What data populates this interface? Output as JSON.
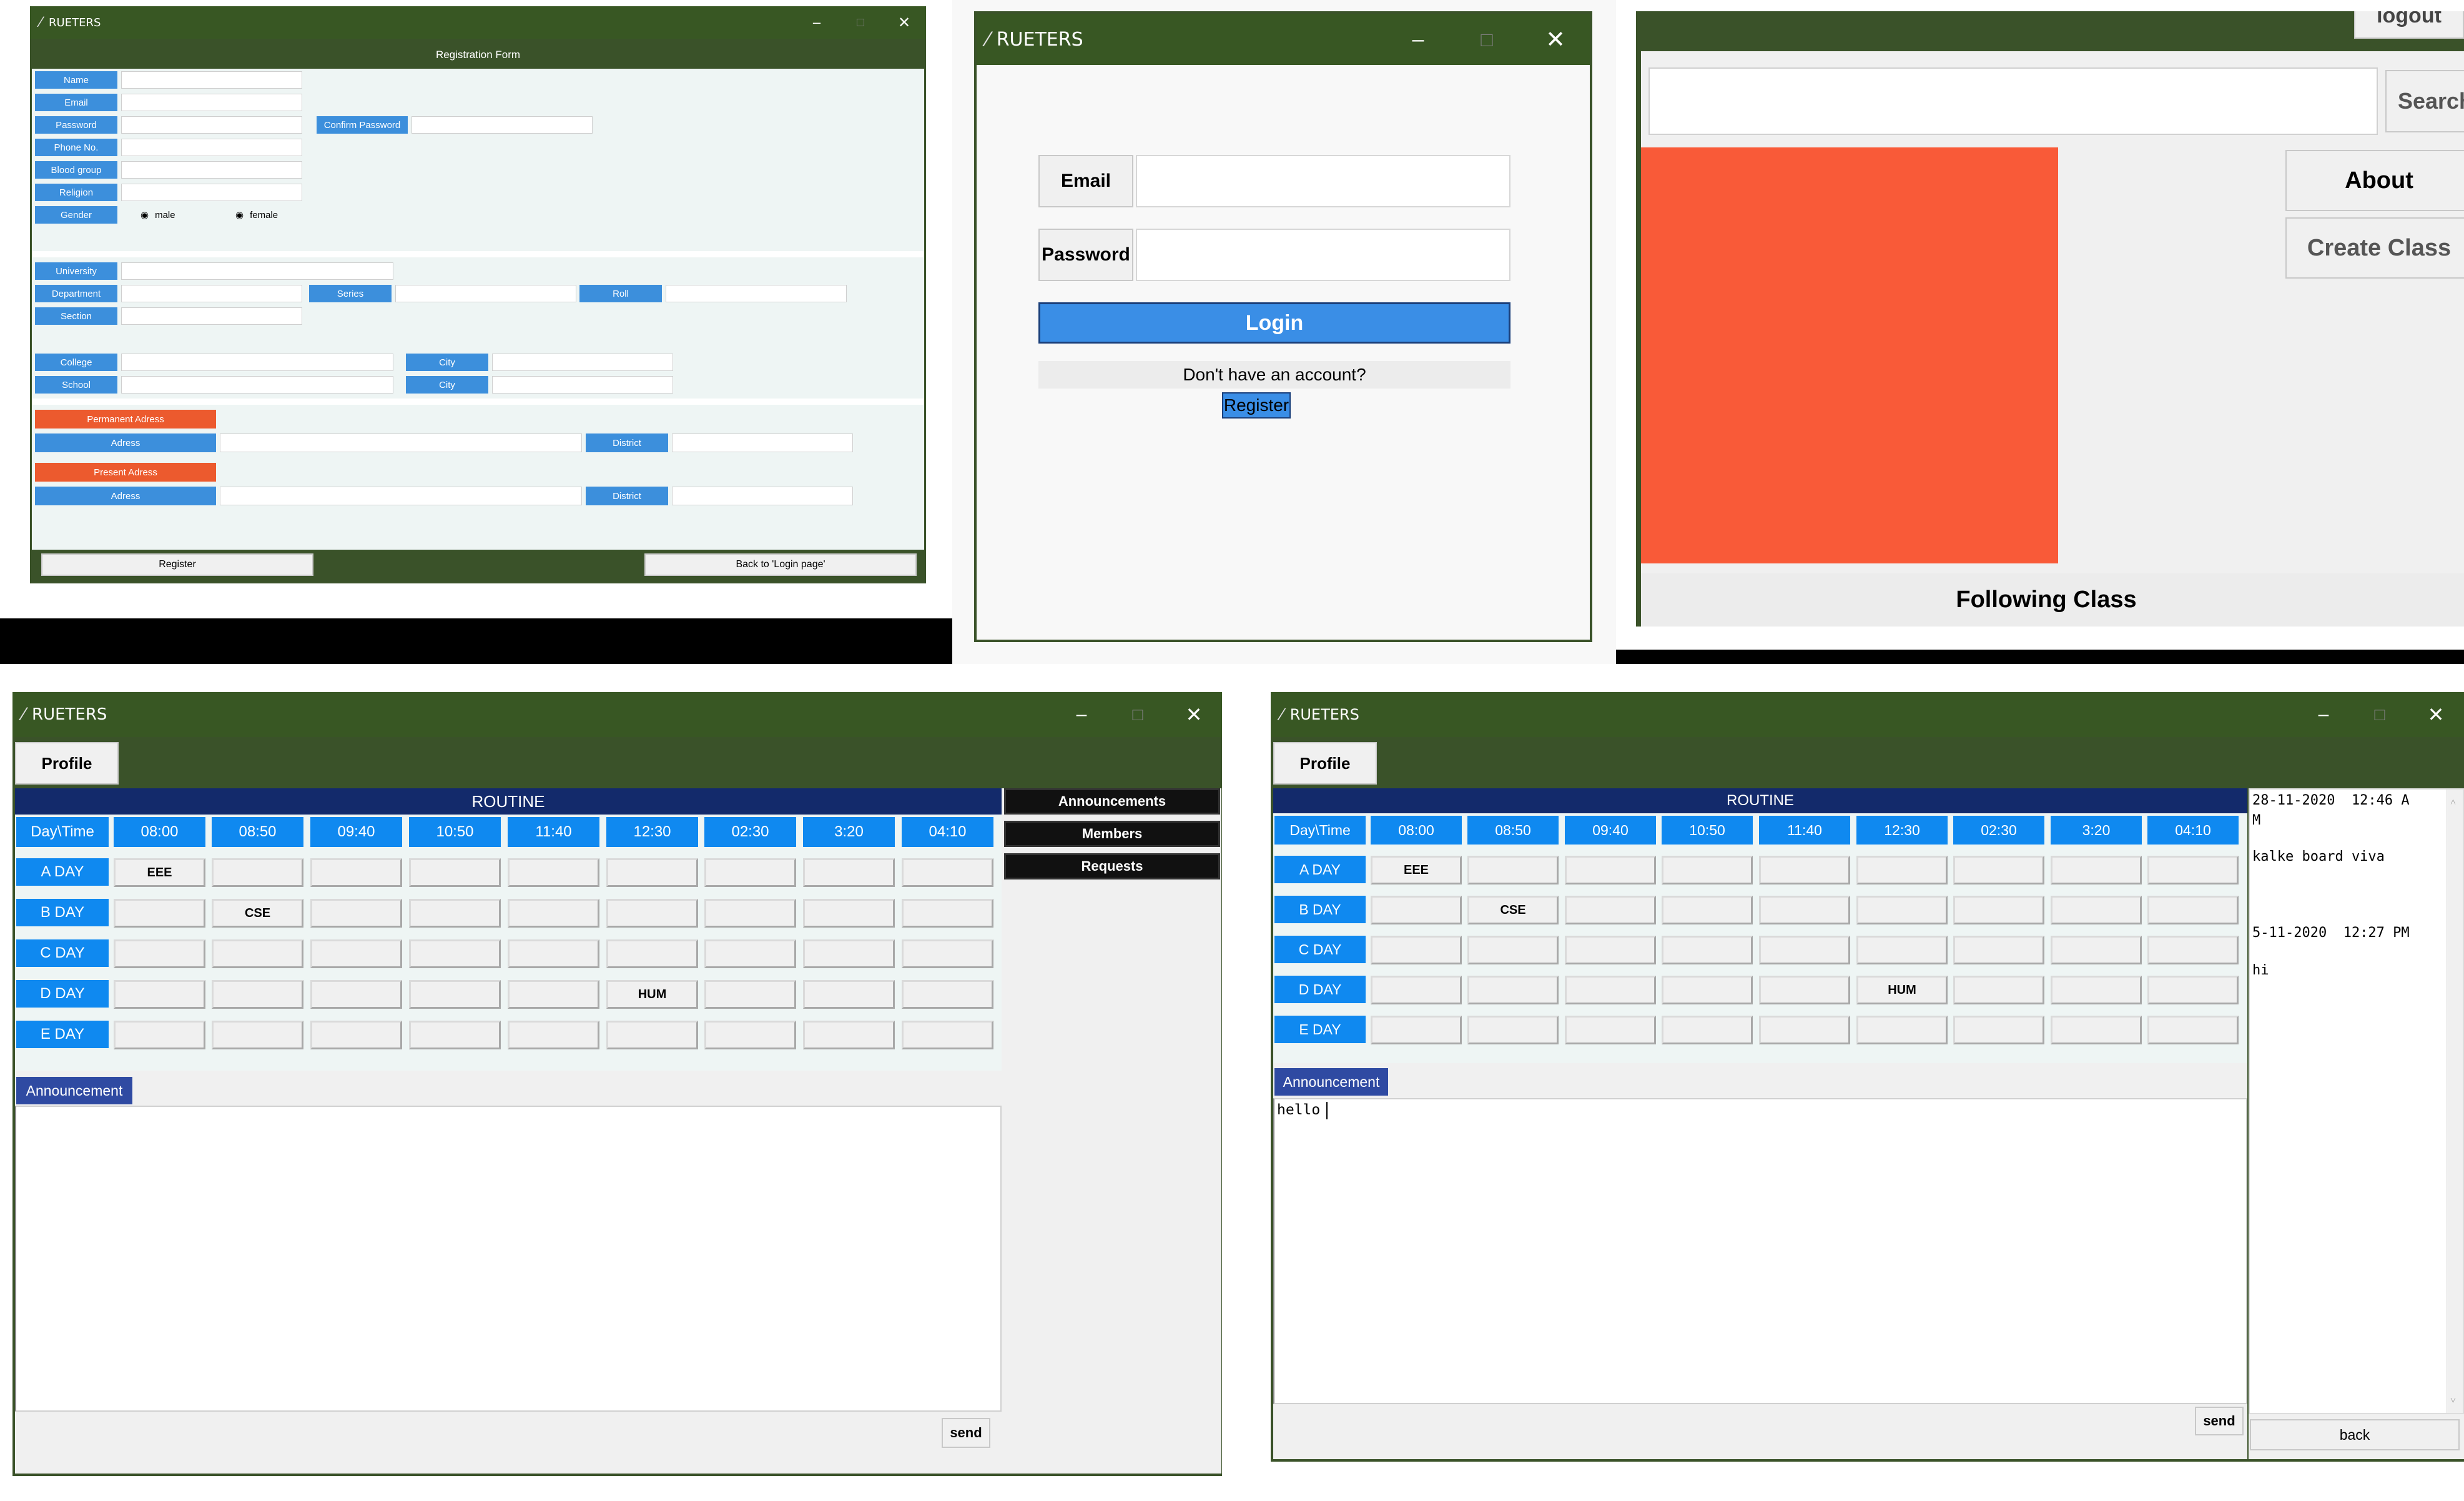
{
  "app_title": "RUETERS",
  "registration": {
    "header": "Registration Form",
    "fields": {
      "name": "Name",
      "email": "Email",
      "password": "Password",
      "confirm_password": "Confirm Password",
      "phone": "Phone No.",
      "blood_group": "Blood group",
      "religion": "Religion",
      "gender": "Gender",
      "male": "male",
      "female": "female",
      "university": "University",
      "department": "Department",
      "series": "Series",
      "roll": "Roll",
      "section": "Section",
      "college": "College",
      "city": "City",
      "school": "School",
      "permanent_address": "Permanent Adress",
      "present_address": "Present Adress",
      "adress": "Adress",
      "district": "District"
    },
    "register_button": "Register",
    "back_button": "Back to 'Login page'"
  },
  "login": {
    "email_label": "Email",
    "password_label": "Password",
    "login_button": "Login",
    "no_account_text": "Don't have an account?",
    "register_link": "Register"
  },
  "home": {
    "logout_partial": "logout",
    "search_button": "Search",
    "about_button": "About",
    "create_class_button": "Create Class",
    "following_class_label": "Following Class"
  },
  "routine": {
    "profile_button": "Profile",
    "header": "ROUTINE",
    "corner": "Day\\Time",
    "times": [
      "08:00",
      "08:50",
      "09:40",
      "10:50",
      "11:40",
      "12:30",
      "02:30",
      "3:20",
      "04:10"
    ],
    "days": [
      "A DAY",
      "B DAY",
      "C DAY",
      "D DAY",
      "E DAY"
    ],
    "cells": [
      [
        "EEE",
        "",
        "",
        "",
        "",
        "",
        "",
        "",
        ""
      ],
      [
        "",
        "CSE",
        "",
        "",
        "",
        "",
        "",
        "",
        ""
      ],
      [
        "",
        "",
        "",
        "",
        "",
        "",
        "",
        "",
        ""
      ],
      [
        "",
        "",
        "",
        "",
        "",
        "HUM",
        "",
        "",
        ""
      ],
      [
        "",
        "",
        "",
        "",
        "",
        "",
        "",
        "",
        ""
      ]
    ],
    "announcement_label": "Announcement",
    "send_button": "send"
  },
  "teacher_panel": {
    "announcements_button": "Announcements",
    "members_button": "Members",
    "requests_button": "Requests"
  },
  "student_panel": {
    "announcement_text": "hello",
    "feed": [
      {
        "date": "28-11-2020  12:46 A",
        "date_cont": "M",
        "message": "kalke board viva"
      },
      {
        "date": "5-11-2020  12:27 PM",
        "date_cont": "",
        "message": "hi"
      }
    ],
    "back_button": "back"
  },
  "colors": {
    "titlebar": "#385723",
    "window_green": "#3a5229",
    "label_blue": "#3c8fdc",
    "cell_blue": "#0f89f0",
    "routine_navy": "#132a6b",
    "login_blue": "#3a8ee6",
    "orange": "#ec5a2e",
    "panel_orange": "#f95a38"
  }
}
